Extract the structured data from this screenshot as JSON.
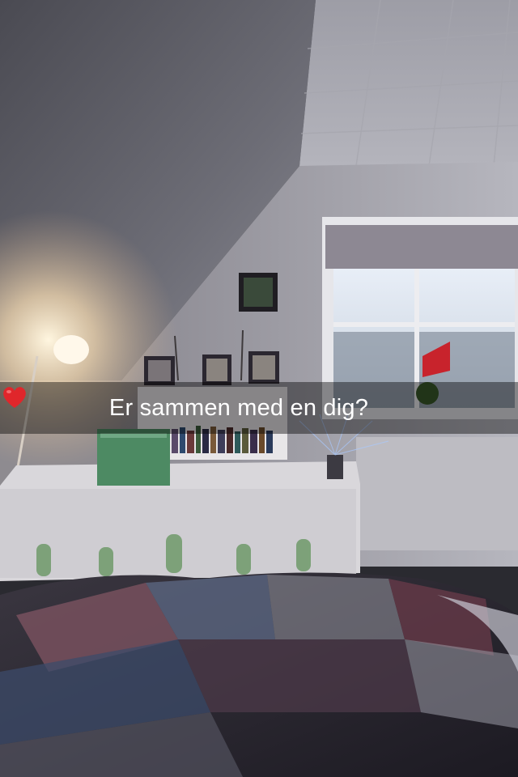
{
  "snap": {
    "caption": "Er sammen med en dig?",
    "caption_emoji": "red-heart-icon"
  },
  "colors": {
    "caption_bar": "#000000",
    "caption_text": "#ffffff",
    "heart": "#e0262b"
  }
}
